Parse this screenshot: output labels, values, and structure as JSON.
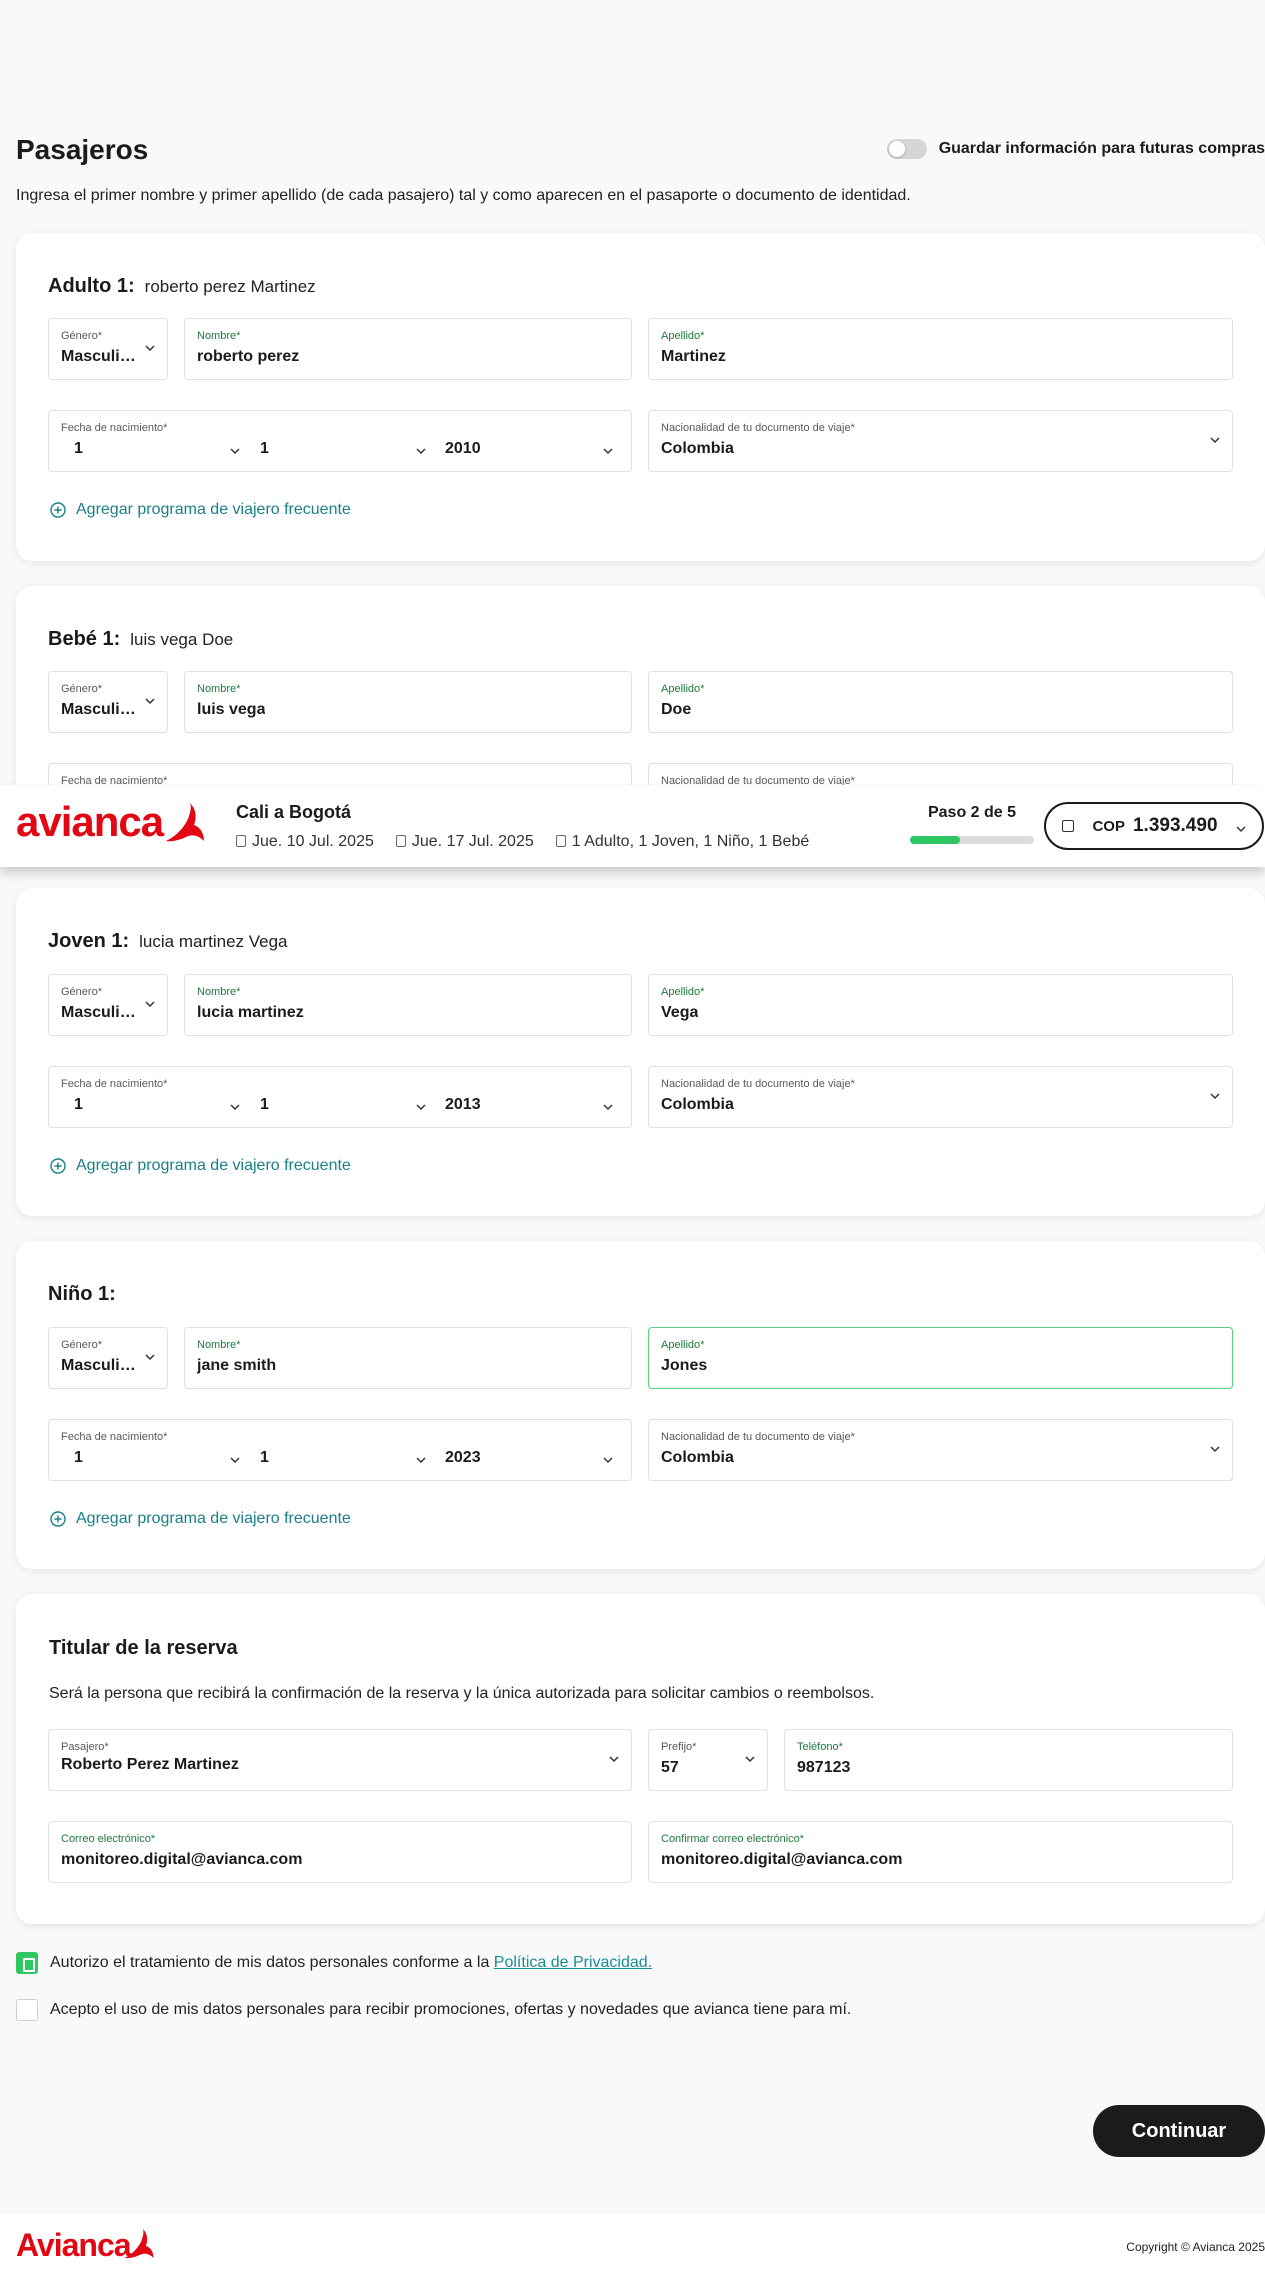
{
  "header": {
    "title": "Pasajeros",
    "save_info_label": "Guardar información para futuras compras",
    "intro": "Ingresa el primer nombre y primer apellido (de cada pasajero) tal y como aparecen en el pasaporte o documento de identidad."
  },
  "labels": {
    "gender": "Género*",
    "first_name": "Nombre*",
    "last_name": "Apellido*",
    "dob": "Fecha de nacimiento*",
    "nationality": "Nacionalidad de tu documento de viaje*",
    "ffp": "Agregar programa de viajero frecuente"
  },
  "passengers": [
    {
      "type": "Adulto 1:",
      "display_name": "roberto perez Martinez",
      "gender": "Masculi…",
      "first_name": "roberto perez",
      "last_name": "Martinez",
      "dob_day": "1",
      "dob_month": "1",
      "dob_year": "2010",
      "nationality": "Colombia"
    },
    {
      "type": "Bebé 1:",
      "display_name": "luis vega Doe",
      "gender": "Masculi…",
      "first_name": "luis vega",
      "last_name": "Doe"
    },
    {
      "type": "Joven 1:",
      "display_name": "lucia martinez Vega",
      "gender": "Masculi…",
      "first_name": "lucia martinez",
      "last_name": "Vega",
      "dob_day": "1",
      "dob_month": "1",
      "dob_year": "2013",
      "nationality": "Colombia"
    },
    {
      "type": "Niño 1:",
      "display_name": "",
      "gender": "Masculi…",
      "first_name": "jane smith",
      "last_name": "Jones",
      "dob_day": "1",
      "dob_month": "1",
      "dob_year": "2023",
      "nationality": "Colombia"
    }
  ],
  "sticky": {
    "logo": "avianca",
    "route": "Cali a Bogotá",
    "outbound": "Jue. 10 Jul. 2025",
    "return": "Jue. 17 Jul. 2025",
    "passengers": "1 Adulto, 1 Joven, 1 Niño, 1 Bebé",
    "step": "Paso 2 de 5",
    "progress": 0.4,
    "currency": "COP",
    "price": "1.393.490"
  },
  "holder": {
    "title": "Titular de la reserva",
    "description": "Será la persona que recibirá la confirmación de la reserva y la única autorizada para solicitar cambios o reembolsos.",
    "passenger_label": "Pasajero*",
    "passenger_value": "Roberto Perez Martinez",
    "prefix_label": "Prefijo*",
    "prefix_value": "57",
    "phone_label": "Teléfono*",
    "phone_value": "987123",
    "email_label": "Correo electrónico*",
    "email_value": "monitoreo.digital@avianca.com",
    "confirm_email_label": "Confirmar correo electrónico*",
    "confirm_email_value": "monitoreo.digital@avianca.com"
  },
  "consents": {
    "privacy_text": "Autorizo el tratamiento de mis datos personales conforme a la",
    "privacy_link": "Política de Privacidad.",
    "promo_text": "Acepto el uso de mis datos personales para recibir promociones, ofertas y novedades que avianca tiene para mí."
  },
  "continue_label": "Continuar",
  "footer": {
    "logo": "Avianca",
    "copyright": "Copyright © Avianca 2025"
  },
  "colors": {
    "brand_red": "#e30613",
    "accent_green": "#2ec764",
    "link_teal": "#1b7f87"
  }
}
